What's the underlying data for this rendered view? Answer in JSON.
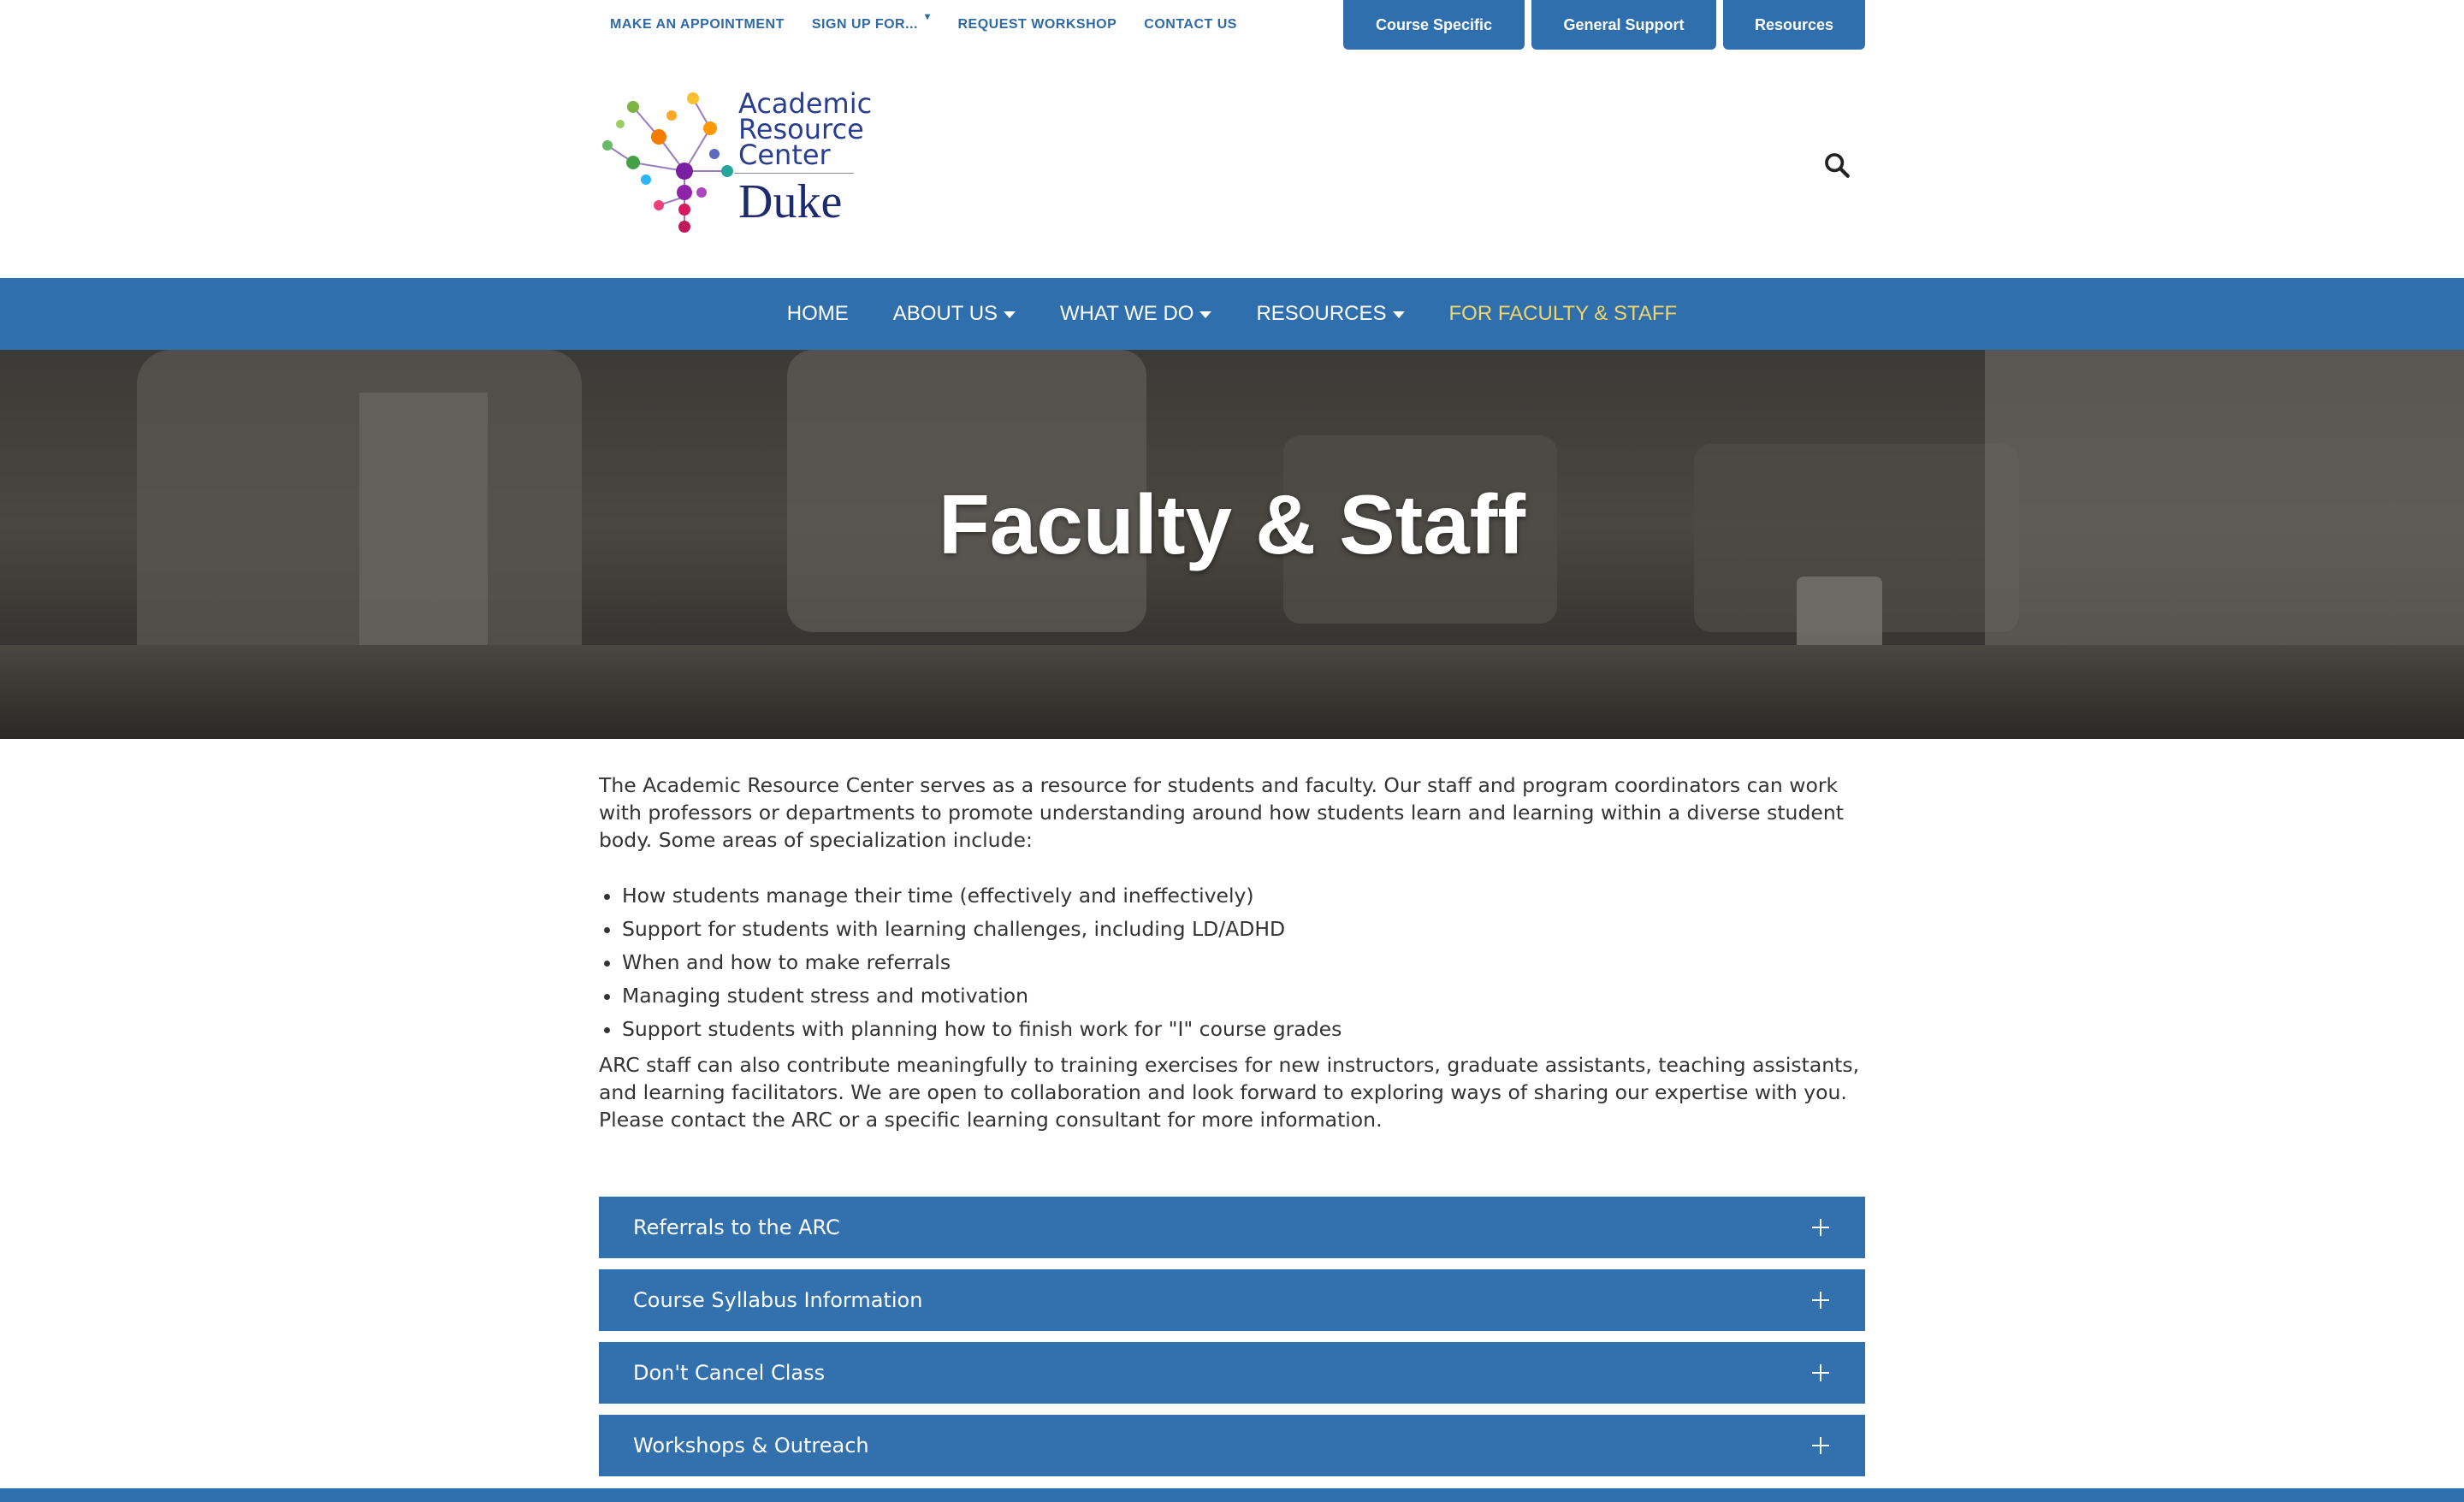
{
  "utility": {
    "links": [
      "MAKE AN APPOINTMENT",
      "SIGN UP FOR...",
      "REQUEST WORKSHOP",
      "CONTACT US"
    ],
    "buttons": [
      "Course Specific",
      "General Support",
      "Resources"
    ]
  },
  "logo": {
    "line1": "Academic",
    "line2": "Resource",
    "line3": "Center",
    "brand": "Duke"
  },
  "nav": {
    "items": [
      "HOME",
      "ABOUT US",
      "WHAT WE DO",
      "RESOURCES",
      "FOR FACULTY & STAFF"
    ],
    "active_color": "#f2d56a"
  },
  "hero": {
    "title": "Faculty & Staff"
  },
  "content": {
    "intro": "The Academic Resource Center serves as a resource for students and faculty. Our staff and program coordinators can work with professors or departments to promote understanding around how students learn and learning within a diverse student body. Some areas of specialization include:",
    "bullets": [
      "How students manage their time (effectively and ineffectively)",
      "Support for students with learning challenges, including LD/ADHD",
      "When and how to make referrals",
      "Managing student stress and motivation",
      "Support students with planning how to finish work for \"I\" course grades"
    ],
    "outro": "ARC staff can also contribute meaningfully to training exercises for new instructors, graduate assistants, teaching assistants, and learning facilitators. We are open to collaboration and look forward to exploring ways of sharing our expertise with you. Please contact the ARC or a specific learning consultant for more information."
  },
  "accordion": [
    "Referrals to the ARC",
    "Course Syllabus Information",
    "Don't Cancel Class",
    "Workshops & Outreach"
  ],
  "colors": {
    "brand_blue": "#2f6fad",
    "accent_gold": "#f2d56a"
  }
}
